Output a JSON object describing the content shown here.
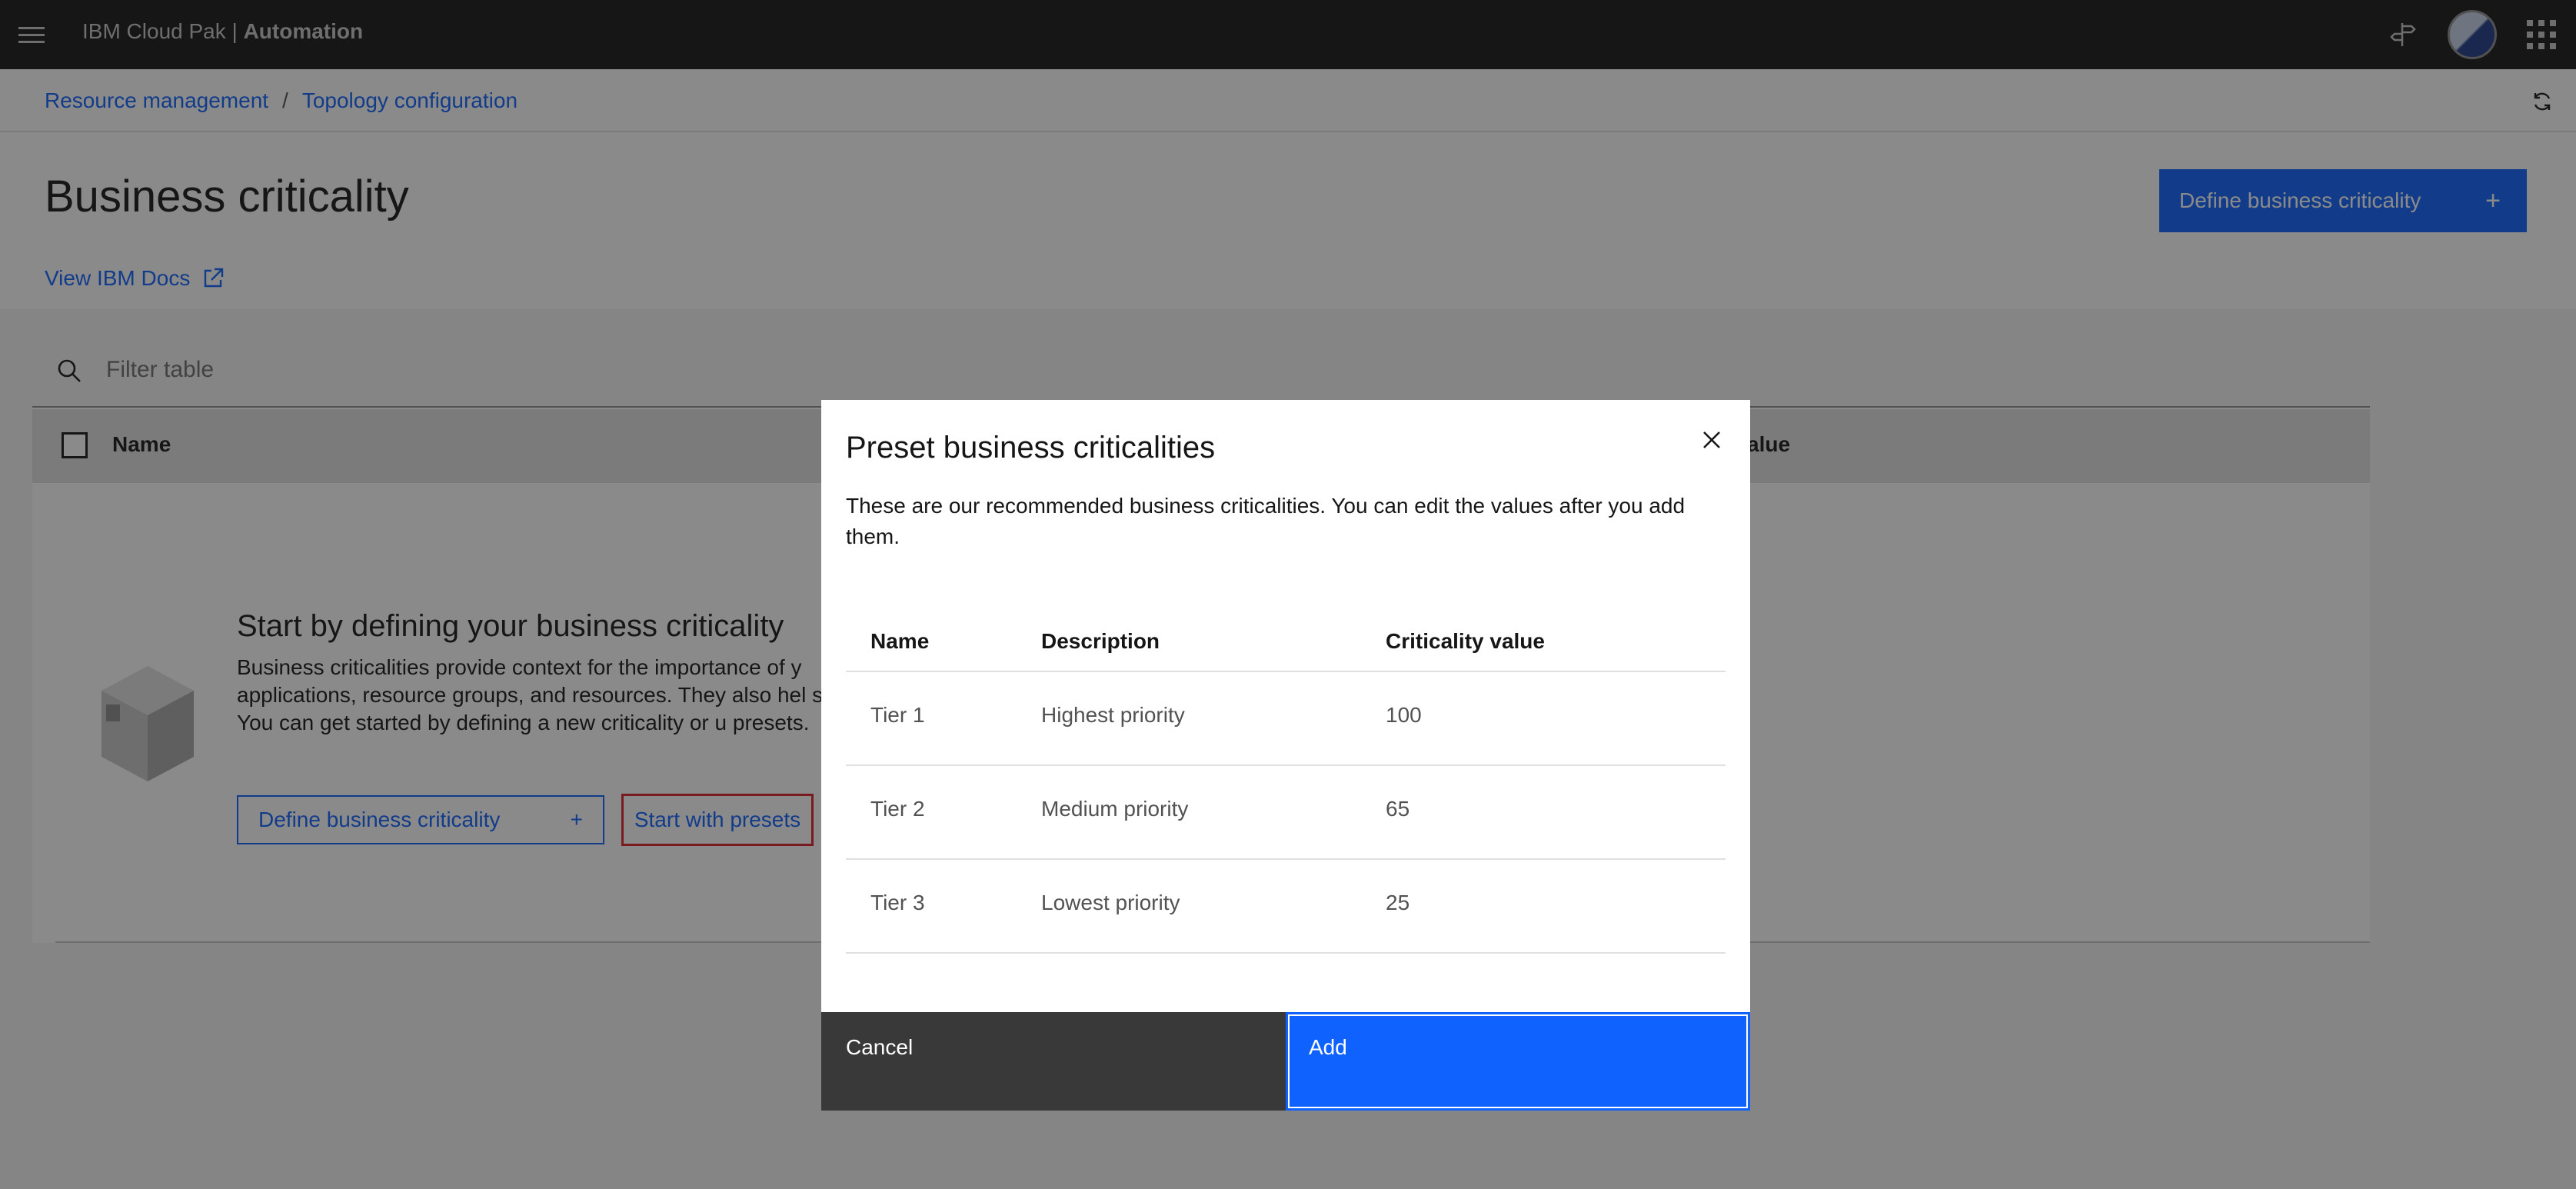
{
  "header": {
    "brand_prefix": "IBM Cloud Pak | ",
    "brand_name": "Automation"
  },
  "breadcrumb": {
    "items": [
      "Resource management",
      "Topology configuration"
    ],
    "separator": "/"
  },
  "page": {
    "title": "Business criticality",
    "docs_link": "View IBM Docs",
    "primary_button": "Define business criticality"
  },
  "table": {
    "filter_placeholder": "Filter table",
    "columns": [
      "Name",
      "Criticality value"
    ],
    "visible_partial_column": "alue"
  },
  "empty_state": {
    "title": "Start by defining your business criticality",
    "description": "Business criticalities provide context for the importance of y applications, resource groups, and resources. They also hel stories. You can get started by defining a new criticality or u presets.",
    "define_button": "Define business criticality",
    "presets_button": "Start with presets"
  },
  "modal": {
    "title": "Preset business criticalities",
    "description": "These are our recommended business criticalities. You can edit the values after you add them.",
    "columns": [
      "Name",
      "Description",
      "Criticality value"
    ],
    "rows": [
      [
        "Tier 1",
        "Highest priority",
        "100"
      ],
      [
        "Tier 2",
        "Medium priority",
        "65"
      ],
      [
        "Tier 3",
        "Lowest priority",
        "25"
      ]
    ],
    "cancel_label": "Cancel",
    "add_label": "Add"
  },
  "colors": {
    "accent": "#0f62fe",
    "header_bg": "#161616",
    "highlight_border": "#da1e28"
  }
}
